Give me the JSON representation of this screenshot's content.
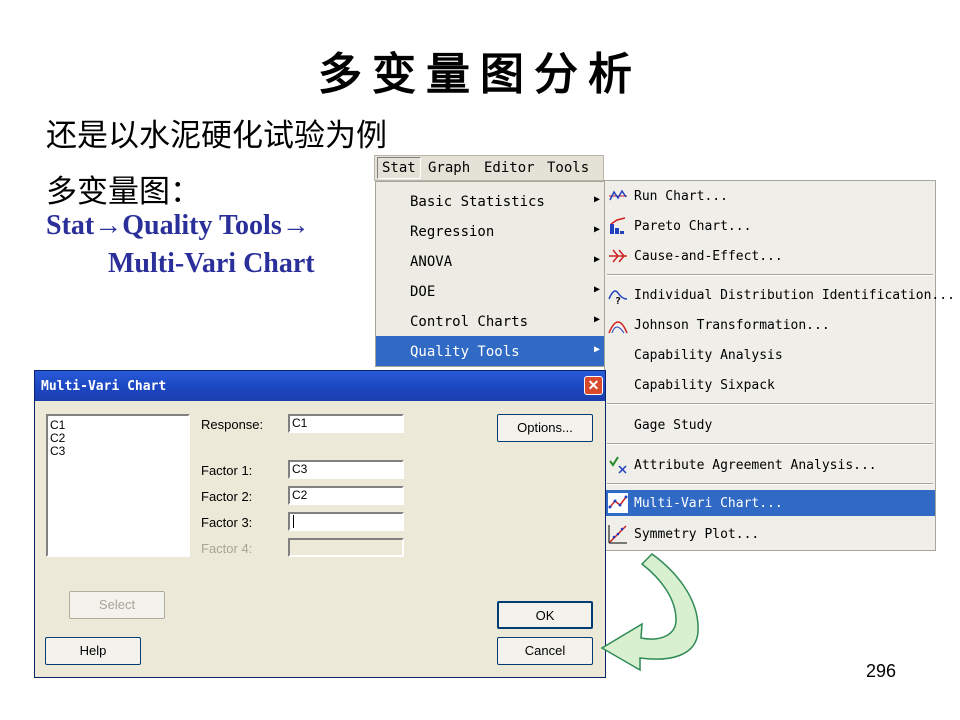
{
  "slide": {
    "title": "多变量图分析",
    "line1": "还是以水泥硬化试验为例",
    "line2": "多变量图：",
    "path1": "Stat→Quality Tools→",
    "path2": "Multi-Vari Chart",
    "page_number": "296"
  },
  "menubar": {
    "items": [
      "Stat",
      "Graph",
      "Editor",
      "Tools"
    ]
  },
  "stat_menu": {
    "items": [
      "Basic Statistics",
      "Regression",
      "ANOVA",
      "DOE",
      "Control Charts",
      "Quality Tools"
    ],
    "selected": "Quality Tools"
  },
  "quality_tools_menu": {
    "items": [
      {
        "label": "Run Chart...",
        "icon": "run-chart-icon"
      },
      {
        "label": "Pareto Chart...",
        "icon": "pareto-chart-icon"
      },
      {
        "label": "Cause-and-Effect...",
        "icon": "cause-effect-icon"
      },
      {
        "label": "Individual Distribution Identification...",
        "icon": "distribution-id-icon"
      },
      {
        "label": "Johnson Transformation...",
        "icon": "johnson-icon"
      },
      {
        "label": "Capability Analysis",
        "icon": ""
      },
      {
        "label": "Capability Sixpack",
        "icon": ""
      },
      {
        "label": "Gage Study",
        "icon": ""
      },
      {
        "label": "Attribute Agreement Analysis...",
        "icon": "attribute-agreement-icon"
      },
      {
        "label": "Multi-Vari Chart...",
        "icon": "multi-vari-icon"
      },
      {
        "label": "Symmetry Plot...",
        "icon": "symmetry-plot-icon"
      }
    ],
    "selected": "Multi-Vari Chart..."
  },
  "dialog": {
    "title": "Multi-Vari Chart",
    "columns": [
      "C1",
      "C2",
      "C3"
    ],
    "response_label": "Response:",
    "response_value": "C1",
    "factor1_label": "Factor 1:",
    "factor1_value": "C3",
    "factor2_label": "Factor 2:",
    "factor2_value": "C2",
    "factor3_label": "Factor 3:",
    "factor3_value": "",
    "factor4_label": "Factor 4:",
    "factor4_value": "",
    "options_button": "Options...",
    "select_button": "Select",
    "help_button": "Help",
    "ok_button": "OK",
    "cancel_button": "Cancel"
  },
  "colors": {
    "menu_highlight": "#316ac5",
    "title_bar": "#1d48c4",
    "path_text": "#2b2f9a",
    "arrow_fill": "#d8f0d0",
    "arrow_stroke": "#2f8a55"
  }
}
